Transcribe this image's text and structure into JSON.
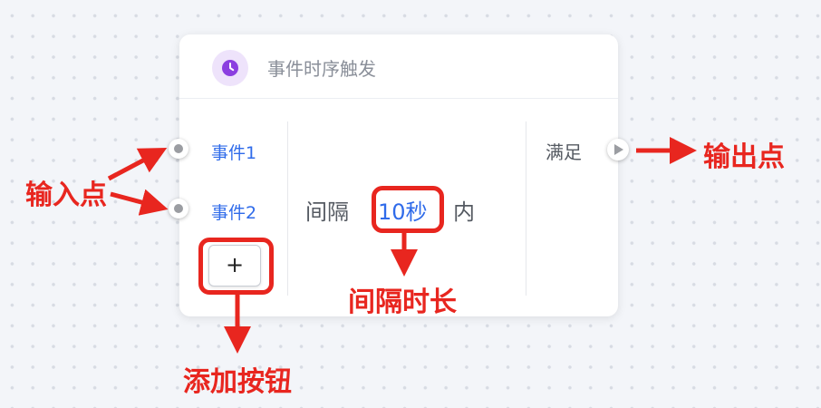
{
  "node": {
    "title": "事件时序触发",
    "icon": "clock-icon",
    "inputs": [
      {
        "label": "事件1"
      },
      {
        "label": "事件2"
      }
    ],
    "add_button_label": "+",
    "interval": {
      "prefix": "间隔",
      "value": "10秒",
      "suffix": "内"
    },
    "output": {
      "label": "满足"
    }
  },
  "annotations": {
    "input_points": "输入点",
    "output_point": "输出点",
    "interval_duration": "间隔时长",
    "add_button": "添加按钮"
  },
  "colors": {
    "annotation": "#e8261f",
    "link": "#2f6bea",
    "icon": "#8b3fe0",
    "icon_bg": "#eee3fb"
  }
}
